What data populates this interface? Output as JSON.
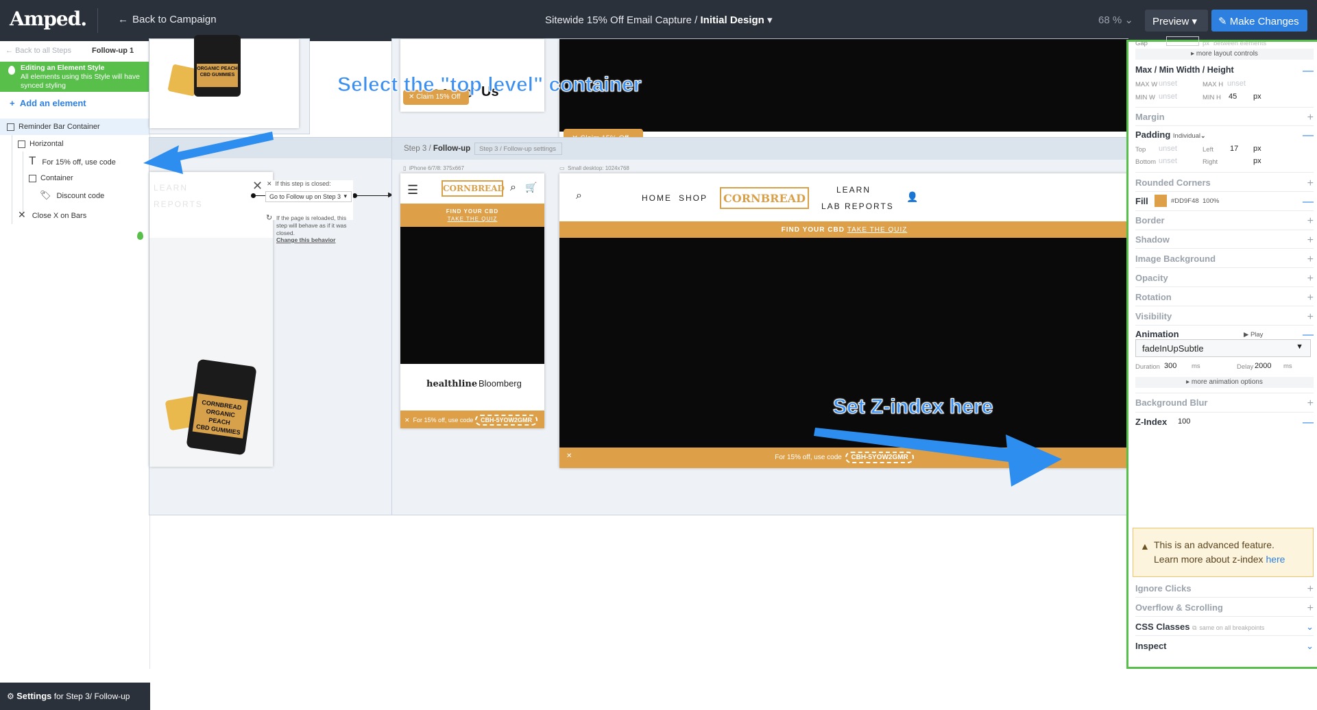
{
  "topbar": {
    "logo": "Amped.",
    "back": "Back to Campaign",
    "title_plain": "Sitewide 15% Off Email Capture / ",
    "title_bold": "Initial Design",
    "zoom": "68 %",
    "preview": "Preview",
    "make_changes": "Make Changes"
  },
  "sidebar": {
    "back_steps": "Back to all Steps",
    "step": "Follow-up 1",
    "style_title": "Editing an Element Style",
    "style_desc": "All elements using this Style will have synced styling",
    "add_element": "Add an element",
    "tree": [
      "Reminder Bar Container",
      "Horizontal",
      "For 15% off, use code",
      "Container",
      "Discount code",
      "Close X on Bars"
    ],
    "settings_bold": "Settings",
    "settings_rest": "for Step 3/ Follow-up"
  },
  "canvas": {
    "claim1": "Claim 15% Off",
    "claim2": "Claim 15% Off",
    "closed_title": "If this step is closed:",
    "closed_select": "Go to Follow up on Step 3",
    "reload_text": "If the page is reloaded, this step will behave as if it was closed.",
    "change_behavior": "Change this behavior",
    "step_label": "Step 3 / ",
    "step_bold": "Follow-up",
    "step_settings": "Step 3 / Follow-up settings",
    "phone_label": "iPhone 6/7/8: 375x667",
    "desktop_label": "Small desktop: 1024x768",
    "brand": "CORNBREAD",
    "find_cbd": "FIND YOUR CBD",
    "take_quiz": "TAKE THE QUIZ",
    "nav": [
      "HOME",
      "SHOP"
    ],
    "nav_learn": "LEARN",
    "nav_lab": "LAB REPORTS",
    "healthline": "healthline",
    "bloomberg": "Bloomberg",
    "for_code": "For 15% off, use code",
    "code": "CBH-5YOW2GMR",
    "jar_line1": "ORGANIC PEACH",
    "jar_line2": "CBD GUMMIES",
    "jar_brand": "CORNBREAD",
    "faded_learn": "LEARN",
    "faded_lab": "REPORTS",
    "annot1": "Select the \"top level\" container",
    "annot2": "Set Z-index here"
  },
  "panel": {
    "gap": "Gap",
    "gap_px": "px",
    "gap_between": "between elements",
    "more_layout": "more layout controls",
    "maxmin": "Max / Min  Width / Height",
    "maxw": "MAX W",
    "maxh": "MAX H",
    "minw": "MIN W",
    "minh": "MIN H",
    "unset": "unset",
    "minh_val": "45",
    "px": "px",
    "margin": "Margin",
    "padding": "Padding",
    "padding_mode": "Individual",
    "top": "Top",
    "left": "Left",
    "left_val": "17",
    "bottom": "Bottom",
    "right": "Right",
    "rounded": "Rounded Corners",
    "fill": "Fill",
    "fill_hex": "#DD9F48",
    "fill_pct": "100%",
    "border": "Border",
    "shadow": "Shadow",
    "image_bg": "Image Background",
    "opacity": "Opacity",
    "rotation": "Rotation",
    "visibility": "Visibility",
    "animation": "Animation",
    "play": "Play",
    "anim_value": "fadeInUpSubtle",
    "duration": "Duration",
    "duration_val": "300",
    "ms": "ms",
    "delay": "Delay",
    "delay_val": "2000",
    "more_anim": "more animation options",
    "bg_blur": "Background Blur",
    "zindex": "Z-Index",
    "zindex_val": "100",
    "warn1": "This is an advanced feature.",
    "warn2": "Learn more about z-index ",
    "warn_link": "here",
    "ignore": "Ignore Clicks",
    "overflow": "Overflow & Scrolling",
    "css": "CSS Classes",
    "css_note": "same on all breakpoints",
    "inspect": "Inspect"
  },
  "colors": {
    "accent": "#2d7fe0",
    "brand": "#dd9f48",
    "green": "#57bf4a",
    "topbar": "#2b313b"
  }
}
